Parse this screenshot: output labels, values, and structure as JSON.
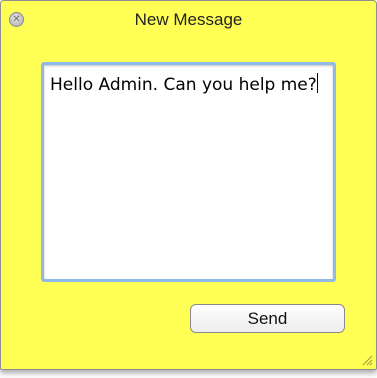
{
  "window": {
    "title": "New Message",
    "background_color": "#ffff55"
  },
  "message": {
    "text": "Hello Admin. Can you help me?"
  },
  "actions": {
    "send_label": "Send"
  },
  "icons": {
    "close": "close-icon",
    "resize": "resize-grip-icon"
  }
}
